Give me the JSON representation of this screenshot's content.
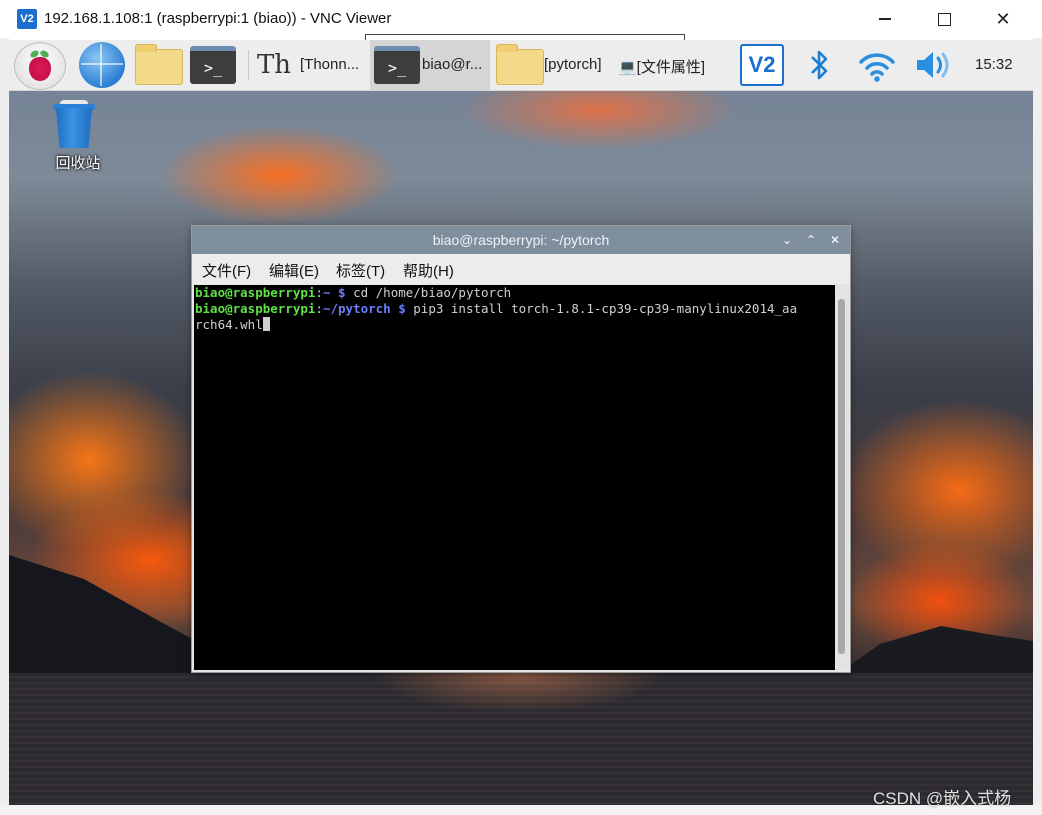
{
  "window": {
    "app_icon": "V2",
    "title": "192.168.1.108:1 (raspberrypi:1 (biao)) - VNC Viewer"
  },
  "taskbar": {
    "items": [
      {
        "name": "raspberry-menu",
        "icon": "raspberry-icon"
      },
      {
        "name": "browser",
        "icon": "globe-icon"
      },
      {
        "name": "file-manager",
        "icon": "folder-icon"
      },
      {
        "name": "terminal",
        "icon": "terminal-icon"
      },
      {
        "name": "thonny-task",
        "icon": "thonny-icon",
        "label": "[Thonn..."
      },
      {
        "name": "terminal-task",
        "icon": "terminal-icon",
        "label": "biao@r..."
      },
      {
        "name": "folder-task",
        "icon": "folder-icon",
        "label": "[pytorch]"
      },
      {
        "name": "properties-task",
        "label": "💻[文件属性]"
      }
    ],
    "tray": {
      "vnc_label": "V2",
      "clock": "15:32"
    }
  },
  "desktop": {
    "trash_label": "回收站"
  },
  "terminal": {
    "title": "biao@raspberrypi: ~/pytorch",
    "menu": [
      "文件(F)",
      "编辑(E)",
      "标签(T)",
      "帮助(H)"
    ],
    "lines": [
      {
        "user": "biao@raspberrypi",
        "path": "~",
        "prompt": "$",
        "command": "cd /home/biao/pytorch"
      },
      {
        "user": "biao@raspberrypi",
        "path": "~/pytorch",
        "prompt": "$",
        "command": "pip3 install torch-1.8.1-cp39-cp39-manylinux2014_aa"
      },
      {
        "continuation": "rch64.whl"
      }
    ]
  },
  "watermark": "CSDN @嵌入式杨",
  "colors": {
    "prompt_user": "#5fe046",
    "prompt_path": "#6b7cff",
    "terminal_bg": "#000000",
    "vnc_blue": "#1a6fce"
  }
}
